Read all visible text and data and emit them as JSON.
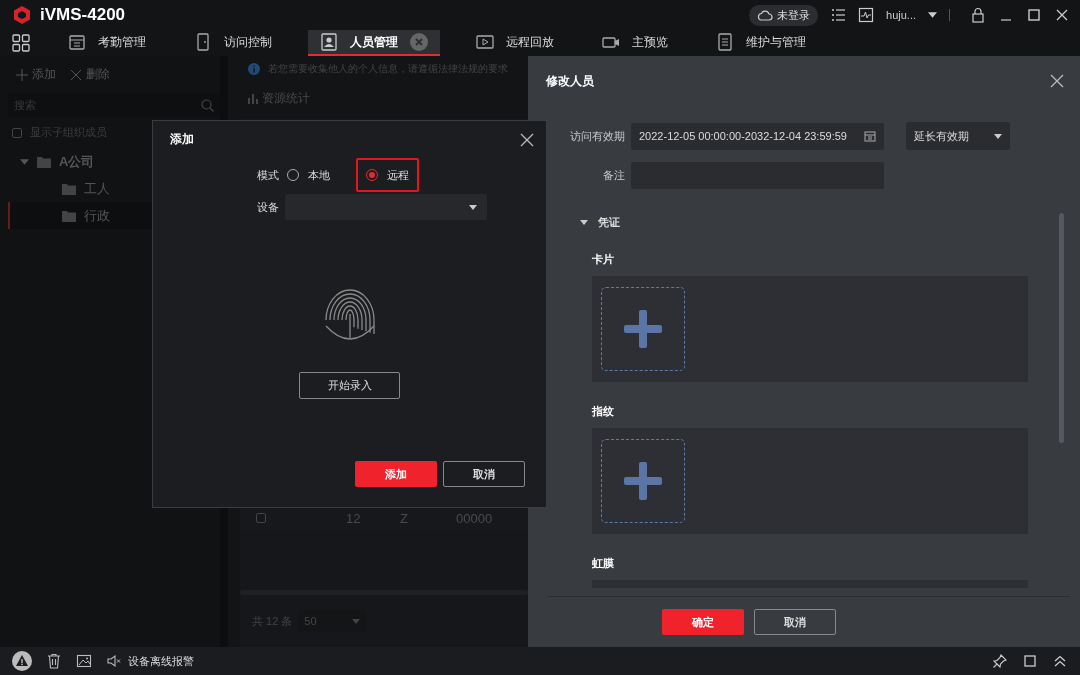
{
  "window": {
    "title": "iVMS-4200",
    "cloud_status": "未登录",
    "user": "huju..."
  },
  "tabs": [
    {
      "label": "考勤管理",
      "selected": false,
      "kind": "calendar"
    },
    {
      "label": "访问控制",
      "selected": false,
      "kind": "door"
    },
    {
      "label": "人员管理",
      "selected": true,
      "kind": "person"
    },
    {
      "label": "远程回放",
      "selected": false,
      "kind": "play"
    },
    {
      "label": "主预览",
      "selected": false,
      "kind": "camera"
    },
    {
      "label": "维护与管理",
      "selected": false,
      "kind": "settings"
    }
  ],
  "sidebar": {
    "actions": [
      {
        "label": "添加",
        "kind": "add"
      },
      {
        "label": "删除",
        "kind": "delete"
      }
    ],
    "search": {
      "placeholder": "搜索"
    },
    "show_sub_members": {
      "label": "显示子组织成员",
      "checked": false
    },
    "tree": [
      {
        "label": "A公司",
        "expanded": true,
        "selected": false,
        "children": [
          {
            "label": "工人",
            "selected": false
          },
          {
            "label": "行政",
            "selected": true
          }
        ]
      }
    ]
  },
  "content": {
    "notice": "若您需要收集他人的个人信息，请遵循法律法规的要求",
    "stats_link": "资源统计",
    "table": {
      "rows": [
        {
          "checked": false,
          "cells": [
            "12",
            "Z",
            "00000"
          ]
        }
      ]
    },
    "footer": {
      "total": "共 12 条",
      "page_size": "50"
    }
  },
  "drawer": {
    "title": "修改人员",
    "fields": [
      {
        "label": "访问有效期",
        "kind": "date",
        "value": "2022-12-05 00:00:00-2032-12-04 23:59:59",
        "extra": "延长有效期"
      },
      {
        "label": "备注",
        "kind": "text"
      }
    ],
    "credentials": {
      "title": "凭证",
      "expanded": true,
      "groups": [
        {
          "label": "卡片"
        },
        {
          "label": "指纹"
        },
        {
          "label": "虹膜"
        }
      ]
    },
    "buttons": [
      "确定",
      "取消"
    ]
  },
  "dialog": {
    "title": "添加",
    "mode_label": "模式",
    "modes": [
      {
        "label": "本地",
        "selected": false,
        "highlighted": false
      },
      {
        "label": "远程",
        "selected": true,
        "highlighted": true
      }
    ],
    "device_label": "设备",
    "start_button": "开始录入",
    "buttons": [
      "添加",
      "取消"
    ]
  },
  "status_bar": {
    "alarm_text": "设备离线报警"
  }
}
